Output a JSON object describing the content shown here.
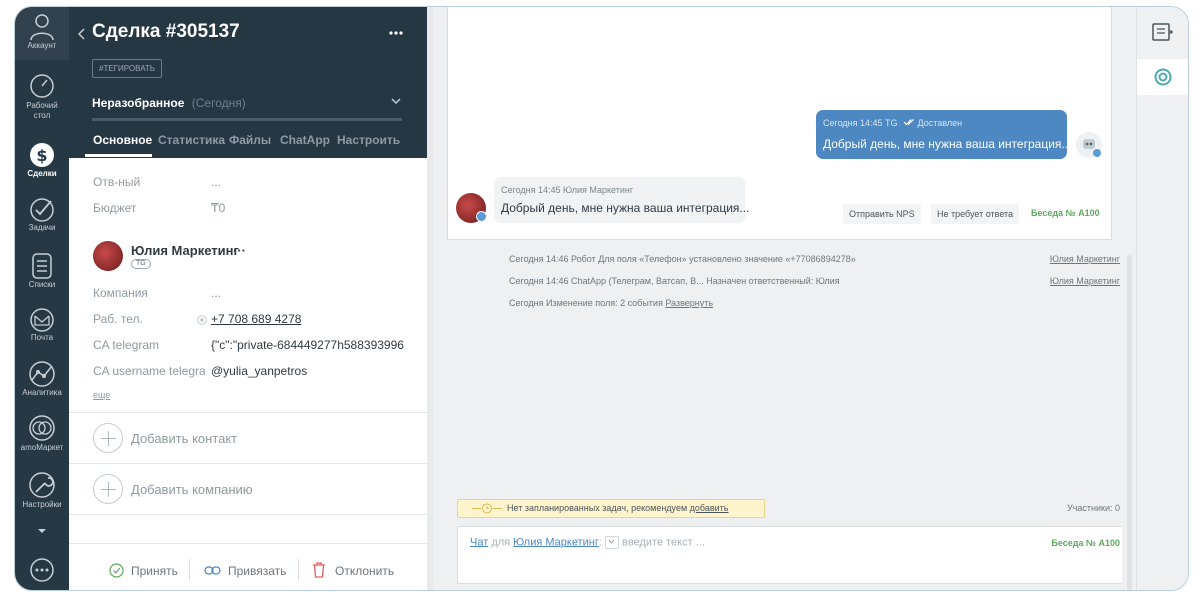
{
  "nav": {
    "account": "Аккаунт",
    "items": [
      {
        "label": "Рабочий стол"
      },
      {
        "label": "Сделки"
      },
      {
        "label": "Задачи"
      },
      {
        "label": "Списки"
      },
      {
        "label": "Почта"
      },
      {
        "label": "Аналитика"
      },
      {
        "label": "amoМаркет"
      },
      {
        "label": "Настройки"
      }
    ]
  },
  "deal": {
    "title": "Сделка #305137",
    "tag_button": "#ТЕГИРОВАТЬ",
    "stage": "Неразобранное",
    "stage_date": "(Сегодня)",
    "tabs": [
      "Основное",
      "Статистика",
      "Файлы",
      "ChatApp",
      "Настроить"
    ],
    "fields": [
      {
        "label": "Отв-ный",
        "value": "..."
      },
      {
        "label": "Бюджет",
        "value": "₸0"
      }
    ],
    "contact": {
      "name": "Юлия Маркетинг",
      "more": "···",
      "badge": "TG",
      "fields": [
        {
          "label": "Компания",
          "value": "..."
        },
        {
          "label": "Раб. тел.",
          "value": "+7 708 689 4278"
        },
        {
          "label": "CA telegram",
          "value": "{\"c\":\"private-684449277h588393996"
        },
        {
          "label": "CA username telegra",
          "value": "@yulia_yanpetros"
        }
      ],
      "more_link": "еще"
    },
    "add_contact": "Добавить контакт",
    "add_company": "Добавить компанию",
    "actions": {
      "accept": "Принять",
      "link": "Привязать",
      "decline": "Отклонить"
    }
  },
  "feed": {
    "outgoing": {
      "meta": "Сегодня 14:45 TG",
      "status": "Доставлен",
      "text": "Добрый день, мне нужна ваша интеграция..."
    },
    "incoming": {
      "meta": "Сегодня 14:45 Юлия Маркетинг",
      "text": "Добрый день, мне нужна ваша интеграция..."
    },
    "chips": [
      "Отправить NPS",
      "Не требует ответа"
    ],
    "conversation": "Беседа № А100",
    "events": [
      {
        "text": "Сегодня 14:46 Робот Для поля «Телефон» установлено значение «+77086894278»",
        "author": "Юлия Маркетинг"
      },
      {
        "text": "Сегодня 14:46 ChatApp (Телеграм, Ватсап, В...   Назначен ответственный: Юлия",
        "author": "Юлия Маркетинг"
      },
      {
        "text": "Сегодня Изменение поля: 2 события",
        "link": "Развернуть"
      }
    ],
    "task_notice": "Нет запланированных задач, рекомендуем",
    "task_add": "добавить",
    "participants": "Участники: 0",
    "composer": {
      "chat": "Чат",
      "for": "для",
      "recipient": "Юлия Маркетинг",
      "placeholder": "введите текст ...",
      "conversation": "Беседа № А100"
    }
  },
  "colors": {
    "nav_bg": "#273845",
    "panel_head": "#263744",
    "outgoing_bubble": "#4d88c2",
    "accent_green": "#5ea95e",
    "task_bg": "#fff4cc"
  }
}
